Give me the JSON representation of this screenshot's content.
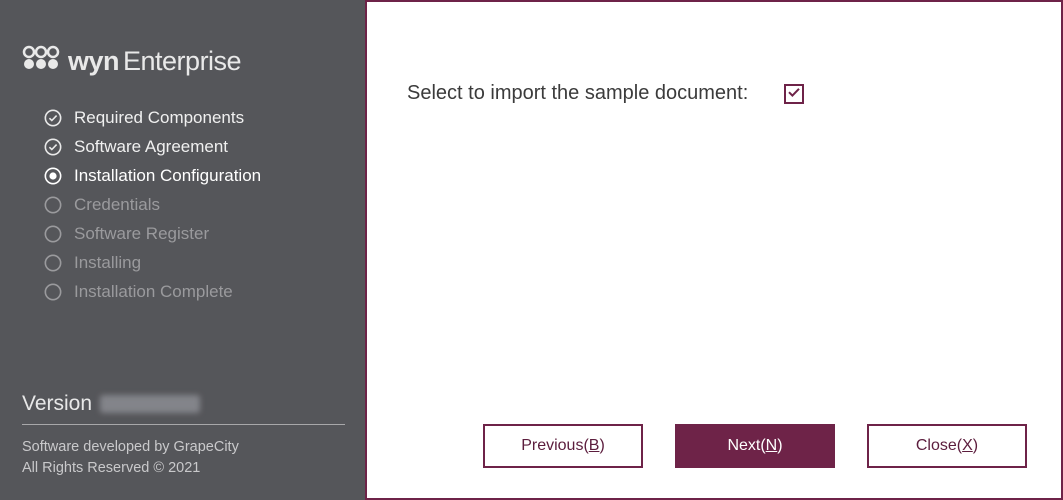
{
  "brand": {
    "name_part1": "wyn",
    "name_part2": "Enterprise"
  },
  "steps": [
    {
      "label": "Required Components",
      "state": "done"
    },
    {
      "label": "Software Agreement",
      "state": "done"
    },
    {
      "label": "Installation Configuration",
      "state": "current"
    },
    {
      "label": "Credentials",
      "state": "pending"
    },
    {
      "label": "Software Register",
      "state": "pending"
    },
    {
      "label": "Installing",
      "state": "pending"
    },
    {
      "label": "Installation Complete",
      "state": "pending"
    }
  ],
  "version_label": "Version",
  "version_value": "",
  "copyright": {
    "line1": "Software developed by GrapeCity",
    "line2": "All Rights Reserved © 2021"
  },
  "main": {
    "prompt": "Select to import the sample document:",
    "import_checked": true
  },
  "buttons": {
    "previous_text": "Previous(",
    "previous_key": "B",
    "previous_close": ")",
    "next_text": "Next(",
    "next_key": "N",
    "next_close": ")",
    "close_text": "Close(",
    "close_key": "X",
    "close_close": ")"
  },
  "colors": {
    "accent": "#6e2348"
  }
}
